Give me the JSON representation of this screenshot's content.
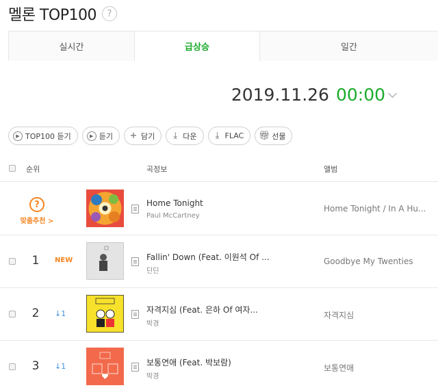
{
  "header": {
    "title": "멜론 TOP100",
    "help_icon": "question-icon"
  },
  "tabs": [
    {
      "label": "실시간",
      "active": false
    },
    {
      "label": "급상승",
      "active": true
    },
    {
      "label": "일간",
      "active": false
    }
  ],
  "date": {
    "date": "2019.11.26",
    "time": "00:00"
  },
  "toolbar": {
    "play_top100": "TOP100 듣기",
    "play": "듣기",
    "add": "담기",
    "download": "다운",
    "flac": "FLAC",
    "gift": "선물"
  },
  "table": {
    "headers": {
      "rank": "순위",
      "song_info": "곡정보",
      "album": "앨범"
    },
    "recommend": {
      "label": "맞춤추천 >",
      "song": "Home Tonight",
      "artist": "Paul McCartney",
      "album": "Home Tonight / In A Hu..."
    },
    "rows": [
      {
        "rank": "1",
        "change": "NEW",
        "song": "Fallin' Down (Feat. 이원석 Of ...",
        "artist": "딘딘",
        "album": "Goodbye My Twenties"
      },
      {
        "rank": "2",
        "change": "1",
        "song": "자격지심 (Feat. 은하 Of 여자...",
        "artist": "박경",
        "album": "자격지심"
      },
      {
        "rank": "3",
        "change": "1",
        "song": "보통연애 (Feat. 박보람)",
        "artist": "박경",
        "album": "보통연애"
      }
    ]
  },
  "colors": {
    "accent_green": "#1aab2b",
    "new_orange": "#f5841f",
    "down_blue": "#3f8fd8"
  }
}
